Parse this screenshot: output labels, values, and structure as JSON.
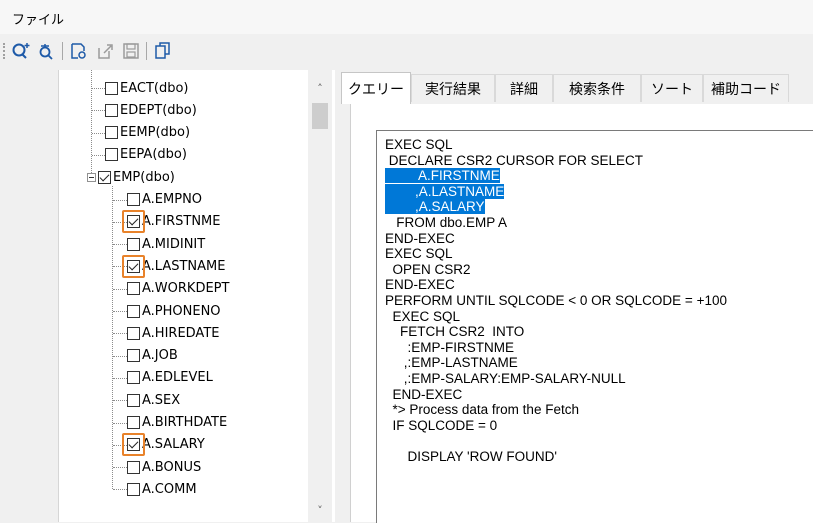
{
  "menu": {
    "file": "ファイル"
  },
  "toolbar": {
    "icons": [
      "query-add-icon",
      "query-run-icon",
      "new-doc-icon",
      "export-icon",
      "save-icon",
      "copy-icon"
    ]
  },
  "tree": {
    "items": [
      {
        "label": "EACT(dbo)",
        "checked": false,
        "highlight": false
      },
      {
        "label": "EDEPT(dbo)",
        "checked": false,
        "highlight": false
      },
      {
        "label": "EEMP(dbo)",
        "checked": false,
        "highlight": false
      },
      {
        "label": "EEPA(dbo)",
        "checked": false,
        "highlight": false
      },
      {
        "label": "EMP(dbo)",
        "checked": true,
        "highlight": false,
        "expanded": true
      },
      {
        "label": "A.EMPNO",
        "checked": false,
        "highlight": false
      },
      {
        "label": "A.FIRSTNME",
        "checked": true,
        "highlight": true
      },
      {
        "label": "A.MIDINIT",
        "checked": false,
        "highlight": false
      },
      {
        "label": "A.LASTNAME",
        "checked": true,
        "highlight": true
      },
      {
        "label": "A.WORKDEPT",
        "checked": false,
        "highlight": false
      },
      {
        "label": "A.PHONENO",
        "checked": false,
        "highlight": false
      },
      {
        "label": "A.HIREDATE",
        "checked": false,
        "highlight": false
      },
      {
        "label": "A.JOB",
        "checked": false,
        "highlight": false
      },
      {
        "label": "A.EDLEVEL",
        "checked": false,
        "highlight": false
      },
      {
        "label": "A.SEX",
        "checked": false,
        "highlight": false
      },
      {
        "label": "A.BIRTHDATE",
        "checked": false,
        "highlight": false
      },
      {
        "label": "A.SALARY",
        "checked": true,
        "highlight": true
      },
      {
        "label": "A.BONUS",
        "checked": false,
        "highlight": false
      },
      {
        "label": "A.COMM",
        "checked": false,
        "highlight": false
      }
    ],
    "highlight_color": "#e8822a"
  },
  "tabs": [
    {
      "label": "クエリー",
      "active": true
    },
    {
      "label": "実行結果",
      "active": false
    },
    {
      "label": "詳細",
      "active": false
    },
    {
      "label": "検索条件",
      "active": false
    },
    {
      "label": "ソート",
      "active": false
    },
    {
      "label": "補助コード",
      "active": false
    }
  ],
  "sql": {
    "selection_color": "#0078d7",
    "lines": [
      "EXEC SQL",
      " DECLARE CSR2 CURSOR FOR SELECT",
      "         A.FIRSTNME",
      "        ,A.LASTNAME",
      "        ,A.SALARY",
      "   FROM dbo.EMP A",
      "END-EXEC",
      "EXEC SQL",
      "  OPEN CSR2",
      "END-EXEC",
      "PERFORM UNTIL SQLCODE < 0 OR SQLCODE = +100",
      "  EXEC SQL",
      "    FETCH CSR2  INTO",
      "      :EMP-FIRSTNME",
      "     ,:EMP-LASTNAME",
      "     ,:EMP-SALARY:EMP-SALARY-NULL",
      "  END-EXEC",
      "  *> Process data from the Fetch",
      "  IF SQLCODE = 0",
      "",
      "      DISPLAY 'ROW FOUND'"
    ]
  }
}
